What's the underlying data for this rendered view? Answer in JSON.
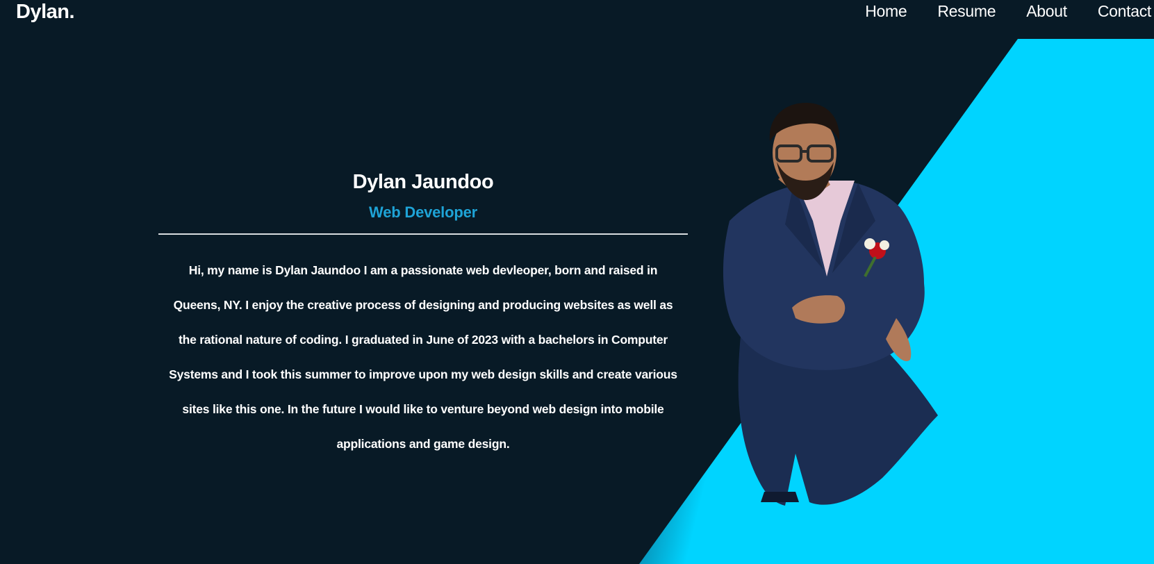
{
  "nav": {
    "brand": "Dylan.",
    "links": [
      "Home",
      "Resume",
      "About",
      "Contact"
    ]
  },
  "hero": {
    "name": "Dylan Jaundoo",
    "role": "Web Developer",
    "bio_parts": [
      "Hi, my name is Dylan Jaundoo I am a passionate web devleoper, born and raised in ",
      "Queens, NY",
      ". I enjoy the creative process of designing and producing websites as well as the rational nature of coding. I graduated in June of 2023 with a bachelors in Computer Systems and I took this summer to improve upon my web design skills and create various sites like this one. In the future I would like to venture beyond web design into mobile applications and game design."
    ]
  },
  "colors": {
    "background": "#081a26",
    "accent": "#00d4ff",
    "role_text": "#1ea3d6"
  }
}
